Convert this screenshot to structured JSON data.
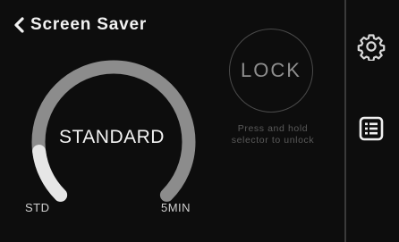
{
  "header": {
    "title": "Screen Saver"
  },
  "dial": {
    "value_label": "STANDARD",
    "min_label": "STD",
    "max_label": "5MIN",
    "level": 0.14,
    "track_color": "#8c8c8c",
    "fill_color": "#e6e6e6"
  },
  "lock": {
    "label": "LOCK",
    "hint": "Press and hold selector to unlock"
  },
  "sidebar": {
    "items": [
      {
        "icon": "gear-icon"
      },
      {
        "icon": "list-icon"
      }
    ]
  }
}
